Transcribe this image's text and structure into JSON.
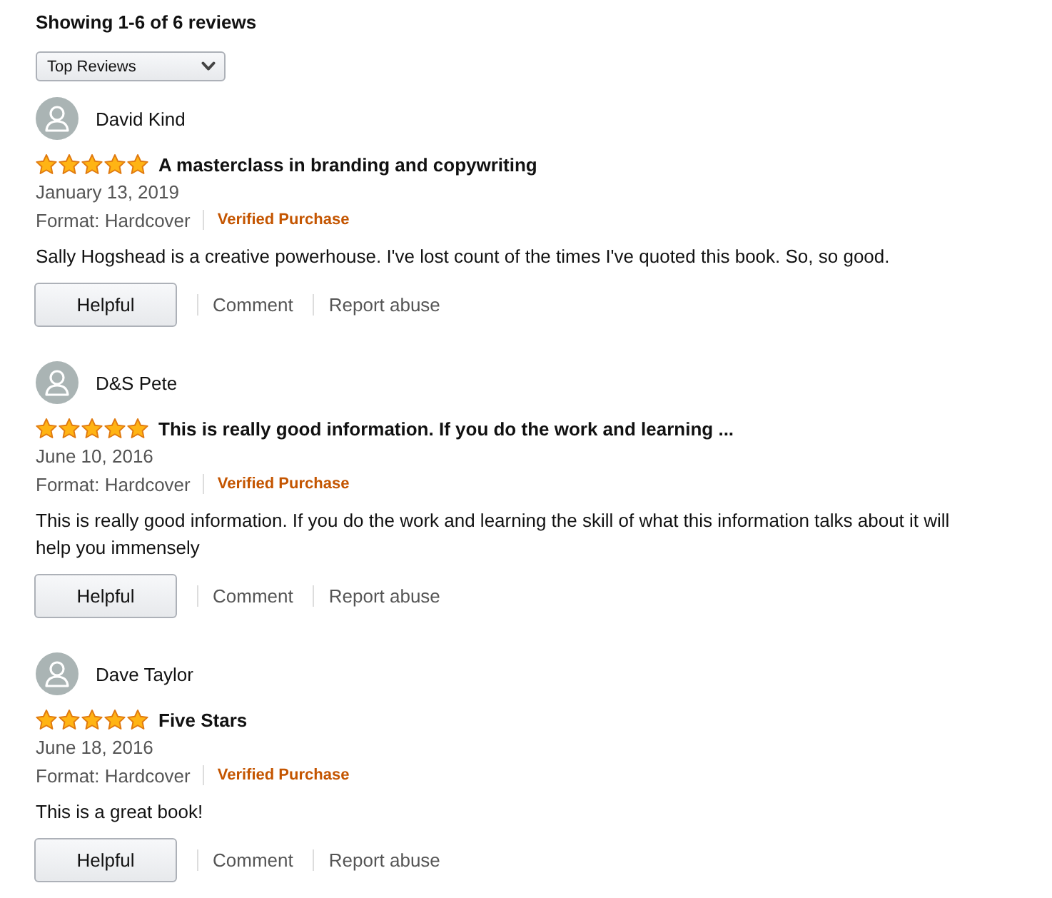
{
  "header": {
    "title": "Showing 1-6 of 6 reviews"
  },
  "sort": {
    "value": "Top Reviews"
  },
  "reviews": [
    {
      "author": "David Kind",
      "stars": 5,
      "title": "A masterclass in branding and copywriting",
      "date": "January 13, 2019",
      "format": "Format: Hardcover",
      "verified": "Verified Purchase",
      "body": "Sally Hogshead is a creative powerhouse. I've lost count of the times I've quoted this book. So, so good.",
      "actions": {
        "helpful": "Helpful",
        "comment": "Comment",
        "report": "Report abuse"
      }
    },
    {
      "author": "D&S Pete",
      "stars": 5,
      "title": "This is really good information. If you do the work and learning ...",
      "date": "June 10, 2016",
      "format": "Format: Hardcover",
      "verified": "Verified Purchase",
      "body": "This is really good information. If you do the work and learning the skill of what this information talks about it will help you immensely",
      "actions": {
        "helpful": "Helpful",
        "comment": "Comment",
        "report": "Report abuse"
      }
    },
    {
      "author": "Dave Taylor",
      "stars": 5,
      "title": "Five Stars",
      "date": "June 18, 2016",
      "format": "Format: Hardcover",
      "verified": "Verified Purchase",
      "body": "This is a great book!",
      "actions": {
        "helpful": "Helpful",
        "comment": "Comment",
        "report": "Report abuse"
      }
    }
  ]
}
